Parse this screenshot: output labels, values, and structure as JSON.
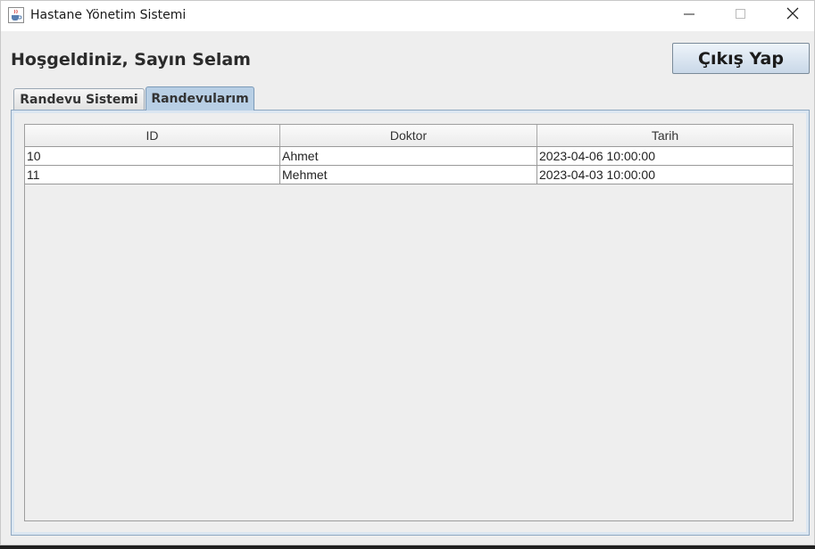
{
  "window": {
    "title": "Hastane Yönetim Sistemi"
  },
  "header": {
    "welcome": "Hoşgeldiniz, Sayın Selam",
    "logout_label": "Çıkış Yap"
  },
  "tabs": [
    {
      "label": "Randevu Sistemi",
      "selected": false
    },
    {
      "label": "Randevularım",
      "selected": true
    }
  ],
  "table": {
    "columns": [
      "ID",
      "Doktor",
      "Tarih"
    ],
    "rows": [
      [
        "10",
        "Ahmet",
        "2023-04-06 10:00:00"
      ],
      [
        "11",
        "Mehmet",
        "2023-04-03 10:00:00"
      ]
    ]
  },
  "icons": {
    "app": "java-coffee-icon",
    "minimize": "minimize-icon",
    "maximize": "maximize-icon",
    "close": "close-icon"
  },
  "colors": {
    "active_tab": "#b8cfe5",
    "button_gradient_top": "#eef4fa",
    "button_gradient_bottom": "#c9d8e8"
  }
}
